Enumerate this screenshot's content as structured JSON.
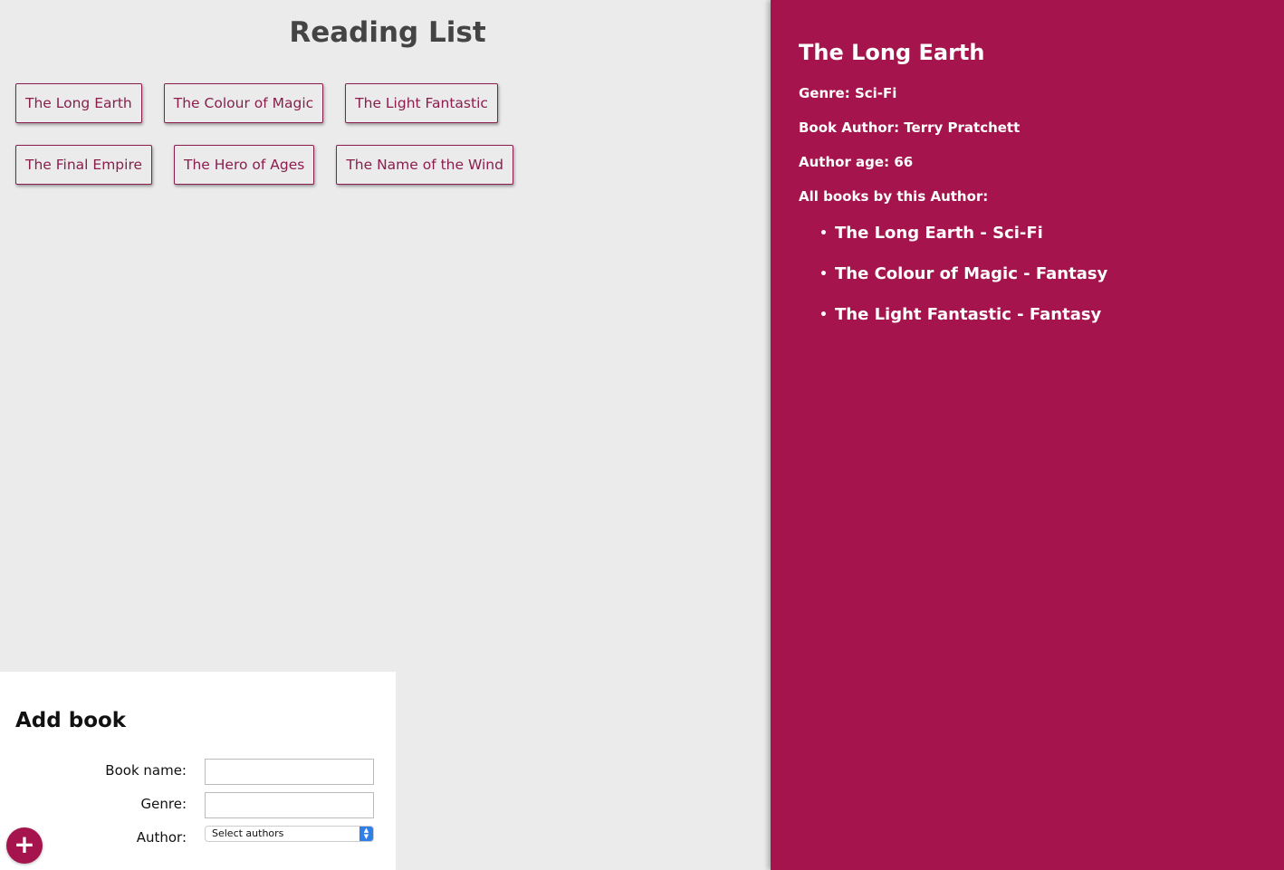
{
  "header": {
    "title": "Reading List"
  },
  "books": [
    {
      "label": "The Long Earth"
    },
    {
      "label": "The Colour of Magic"
    },
    {
      "label": "The Light Fantastic"
    },
    {
      "label": "The Final Empire"
    },
    {
      "label": "The Hero of Ages"
    },
    {
      "label": "The Name of the Wind"
    }
  ],
  "details": {
    "title": "The Long Earth",
    "genre": "Genre: Sci-Fi",
    "author": "Book Author: Terry Pratchett",
    "author_age": "Author age: 66",
    "all_books_label": "All books by this Author:",
    "author_books": [
      "The Long Earth - Sci-Fi",
      "The Colour of Magic - Fantasy",
      "The Light Fantastic - Fantasy"
    ]
  },
  "add_book": {
    "title": "Add book",
    "book_name_label": "Book name:",
    "book_name_value": "",
    "genre_label": "Genre:",
    "genre_value": "",
    "author_label": "Author:",
    "author_select_value": "Select authors",
    "add_button_label": "+"
  },
  "colors": {
    "accent": "#a5144c",
    "book_text": "#8a1e4d",
    "background": "#ebebeb"
  }
}
